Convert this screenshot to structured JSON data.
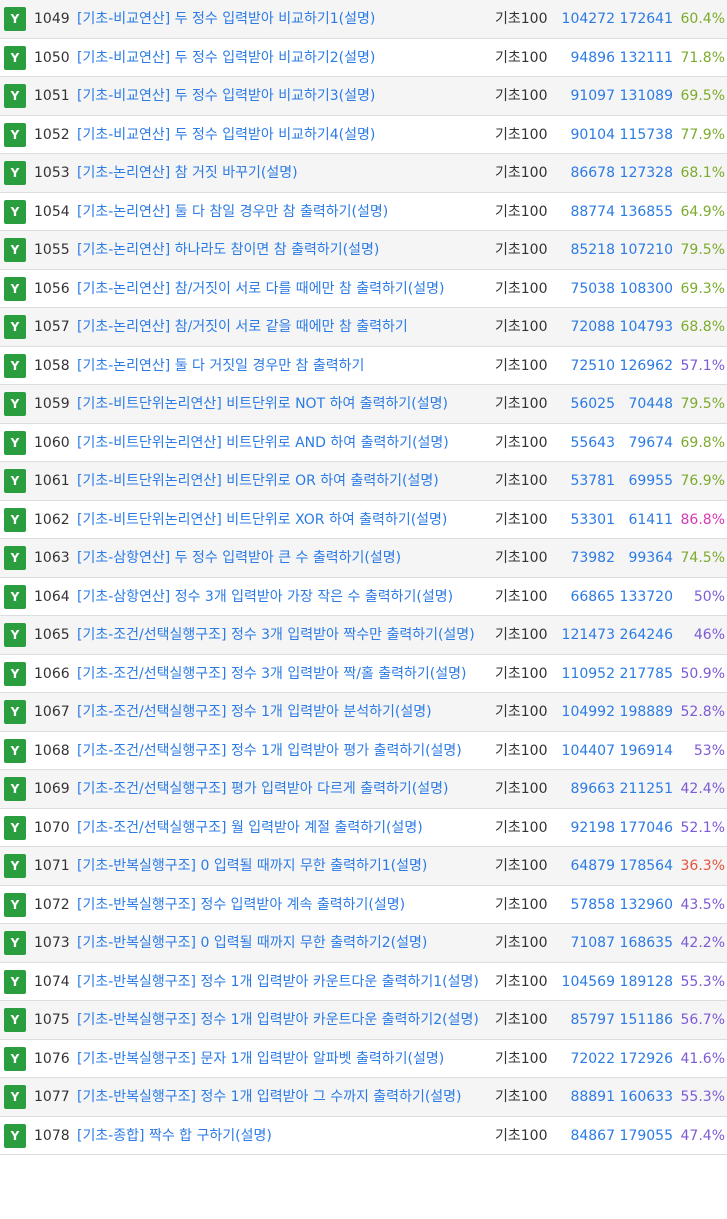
{
  "badge_label": "Y",
  "colors": {
    "badge": "#2a9e3f",
    "link": "#2c7be5",
    "rate_green": "#7cab2d",
    "rate_purple": "#7e5ad6",
    "rate_pink": "#d83ab6",
    "rate_red": "#e5533d"
  },
  "rows": [
    {
      "id": "1049",
      "title": "[기초-비교연산] 두 정수 입력받아 비교하기1(설명)",
      "source": "기초100",
      "solved": "104272",
      "submissions": "172641",
      "rate": "60.4%",
      "rate_color": "green"
    },
    {
      "id": "1050",
      "title": "[기초-비교연산] 두 정수 입력받아 비교하기2(설명)",
      "source": "기초100",
      "solved": "94896",
      "submissions": "132111",
      "rate": "71.8%",
      "rate_color": "green"
    },
    {
      "id": "1051",
      "title": "[기초-비교연산] 두 정수 입력받아 비교하기3(설명)",
      "source": "기초100",
      "solved": "91097",
      "submissions": "131089",
      "rate": "69.5%",
      "rate_color": "green"
    },
    {
      "id": "1052",
      "title": "[기초-비교연산] 두 정수 입력받아 비교하기4(설명)",
      "source": "기초100",
      "solved": "90104",
      "submissions": "115738",
      "rate": "77.9%",
      "rate_color": "green"
    },
    {
      "id": "1053",
      "title": "[기초-논리연산] 참 거짓 바꾸기(설명)",
      "source": "기초100",
      "solved": "86678",
      "submissions": "127328",
      "rate": "68.1%",
      "rate_color": "green"
    },
    {
      "id": "1054",
      "title": "[기초-논리연산] 둘 다 참일 경우만 참 출력하기(설명)",
      "source": "기초100",
      "solved": "88774",
      "submissions": "136855",
      "rate": "64.9%",
      "rate_color": "green"
    },
    {
      "id": "1055",
      "title": "[기초-논리연산] 하나라도 참이면 참 출력하기(설명)",
      "source": "기초100",
      "solved": "85218",
      "submissions": "107210",
      "rate": "79.5%",
      "rate_color": "green"
    },
    {
      "id": "1056",
      "title": "[기초-논리연산] 참/거짓이 서로 다를 때에만 참 출력하기(설명)",
      "source": "기초100",
      "solved": "75038",
      "submissions": "108300",
      "rate": "69.3%",
      "rate_color": "green"
    },
    {
      "id": "1057",
      "title": "[기초-논리연산] 참/거짓이 서로 같을 때에만 참 출력하기",
      "source": "기초100",
      "solved": "72088",
      "submissions": "104793",
      "rate": "68.8%",
      "rate_color": "green"
    },
    {
      "id": "1058",
      "title": "[기초-논리연산] 둘 다 거짓일 경우만 참 출력하기",
      "source": "기초100",
      "solved": "72510",
      "submissions": "126962",
      "rate": "57.1%",
      "rate_color": "purple"
    },
    {
      "id": "1059",
      "title": "[기초-비트단위논리연산] 비트단위로 NOT 하여 출력하기(설명)",
      "source": "기초100",
      "solved": "56025",
      "submissions": "70448",
      "rate": "79.5%",
      "rate_color": "green"
    },
    {
      "id": "1060",
      "title": "[기초-비트단위논리연산] 비트단위로 AND 하여 출력하기(설명)",
      "source": "기초100",
      "solved": "55643",
      "submissions": "79674",
      "rate": "69.8%",
      "rate_color": "green"
    },
    {
      "id": "1061",
      "title": "[기초-비트단위논리연산] 비트단위로 OR 하여 출력하기(설명)",
      "source": "기초100",
      "solved": "53781",
      "submissions": "69955",
      "rate": "76.9%",
      "rate_color": "green"
    },
    {
      "id": "1062",
      "title": "[기초-비트단위논리연산] 비트단위로 XOR 하여 출력하기(설명)",
      "source": "기초100",
      "solved": "53301",
      "submissions": "61411",
      "rate": "86.8%",
      "rate_color": "pink"
    },
    {
      "id": "1063",
      "title": "[기초-삼항연산] 두 정수 입력받아 큰 수 출력하기(설명)",
      "source": "기초100",
      "solved": "73982",
      "submissions": "99364",
      "rate": "74.5%",
      "rate_color": "green"
    },
    {
      "id": "1064",
      "title": "[기초-삼항연산] 정수 3개 입력받아 가장 작은 수 출력하기(설명)",
      "source": "기초100",
      "solved": "66865",
      "submissions": "133720",
      "rate": "50%",
      "rate_color": "purple"
    },
    {
      "id": "1065",
      "title": "[기초-조건/선택실행구조] 정수 3개 입력받아 짝수만 출력하기(설명)",
      "source": "기초100",
      "solved": "121473",
      "submissions": "264246",
      "rate": "46%",
      "rate_color": "purple"
    },
    {
      "id": "1066",
      "title": "[기초-조건/선택실행구조] 정수 3개 입력받아 짝/홀 출력하기(설명)",
      "source": "기초100",
      "solved": "110952",
      "submissions": "217785",
      "rate": "50.9%",
      "rate_color": "purple"
    },
    {
      "id": "1067",
      "title": "[기초-조건/선택실행구조] 정수 1개 입력받아 분석하기(설명)",
      "source": "기초100",
      "solved": "104992",
      "submissions": "198889",
      "rate": "52.8%",
      "rate_color": "purple"
    },
    {
      "id": "1068",
      "title": "[기초-조건/선택실행구조] 정수 1개 입력받아 평가 출력하기(설명)",
      "source": "기초100",
      "solved": "104407",
      "submissions": "196914",
      "rate": "53%",
      "rate_color": "purple"
    },
    {
      "id": "1069",
      "title": "[기초-조건/선택실행구조] 평가 입력받아 다르게 출력하기(설명)",
      "source": "기초100",
      "solved": "89663",
      "submissions": "211251",
      "rate": "42.4%",
      "rate_color": "purple"
    },
    {
      "id": "1070",
      "title": "[기초-조건/선택실행구조] 월 입력받아 계절 출력하기(설명)",
      "source": "기초100",
      "solved": "92198",
      "submissions": "177046",
      "rate": "52.1%",
      "rate_color": "purple"
    },
    {
      "id": "1071",
      "title": "[기초-반복실행구조] 0 입력될 때까지 무한 출력하기1(설명)",
      "source": "기초100",
      "solved": "64879",
      "submissions": "178564",
      "rate": "36.3%",
      "rate_color": "red"
    },
    {
      "id": "1072",
      "title": "[기초-반복실행구조] 정수 입력받아 계속 출력하기(설명)",
      "source": "기초100",
      "solved": "57858",
      "submissions": "132960",
      "rate": "43.5%",
      "rate_color": "purple"
    },
    {
      "id": "1073",
      "title": "[기초-반복실행구조] 0 입력될 때까지 무한 출력하기2(설명)",
      "source": "기초100",
      "solved": "71087",
      "submissions": "168635",
      "rate": "42.2%",
      "rate_color": "purple"
    },
    {
      "id": "1074",
      "title": "[기초-반복실행구조] 정수 1개 입력받아 카운트다운 출력하기1(설명)",
      "source": "기초100",
      "solved": "104569",
      "submissions": "189128",
      "rate": "55.3%",
      "rate_color": "purple"
    },
    {
      "id": "1075",
      "title": "[기초-반복실행구조] 정수 1개 입력받아 카운트다운 출력하기2(설명)",
      "source": "기초100",
      "solved": "85797",
      "submissions": "151186",
      "rate": "56.7%",
      "rate_color": "purple"
    },
    {
      "id": "1076",
      "title": "[기초-반복실행구조] 문자 1개 입력받아 알파벳 출력하기(설명)",
      "source": "기초100",
      "solved": "72022",
      "submissions": "172926",
      "rate": "41.6%",
      "rate_color": "purple"
    },
    {
      "id": "1077",
      "title": "[기초-반복실행구조] 정수 1개 입력받아 그 수까지 출력하기(설명)",
      "source": "기초100",
      "solved": "88891",
      "submissions": "160633",
      "rate": "55.3%",
      "rate_color": "purple"
    },
    {
      "id": "1078",
      "title": "[기초-종합] 짝수 합 구하기(설명)",
      "source": "기초100",
      "solved": "84867",
      "submissions": "179055",
      "rate": "47.4%",
      "rate_color": "purple"
    }
  ]
}
